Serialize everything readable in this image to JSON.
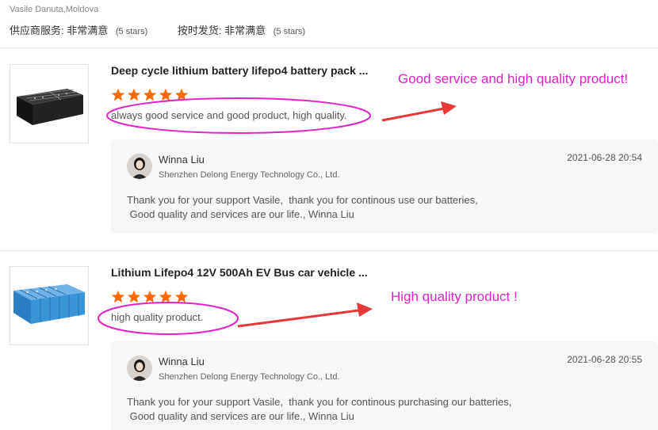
{
  "reviewer": {
    "name_location": "Vasile Danuta,Moldova"
  },
  "supplier_ratings": [
    {
      "label": "供应商服务:",
      "value": "非常满意",
      "stars": "(5 stars)"
    },
    {
      "label": "按时发货:",
      "value": "非常满意",
      "stars": "(5 stars)"
    }
  ],
  "reviews": [
    {
      "product_title": "Deep cycle lithium battery lifepo4 battery pack ...",
      "rating": 5,
      "comment": "always good service and good product, high quality.",
      "annotation": "Good service and high quality product!",
      "reply": {
        "name": "Winna Liu",
        "company": "Shenzhen Delong Energy Technology Co., Ltd.",
        "date": "2021-06-28 20:54",
        "text": "Thank you for your support Vasile,  thank you for continous use our batteries,\n Good quality and services are our life., Winna Liu"
      }
    },
    {
      "product_title": "Lithium Lifepo4 12V 500Ah EV Bus car vehicle ...",
      "rating": 5,
      "comment": "high quality product.",
      "annotation": "High quality product !",
      "reply": {
        "name": "Winna Liu",
        "company": "Shenzhen Delong Energy Technology Co., Ltd.",
        "date": "2021-06-28 20:55",
        "text": "Thank you for your support Vasile,  thank you for continous purchasing our batteries,\n Good quality and services are our life., Winna Liu"
      }
    }
  ],
  "colors": {
    "star": "#ff6a00",
    "annotation": "#e022c8",
    "arrow": "#e8383a"
  }
}
